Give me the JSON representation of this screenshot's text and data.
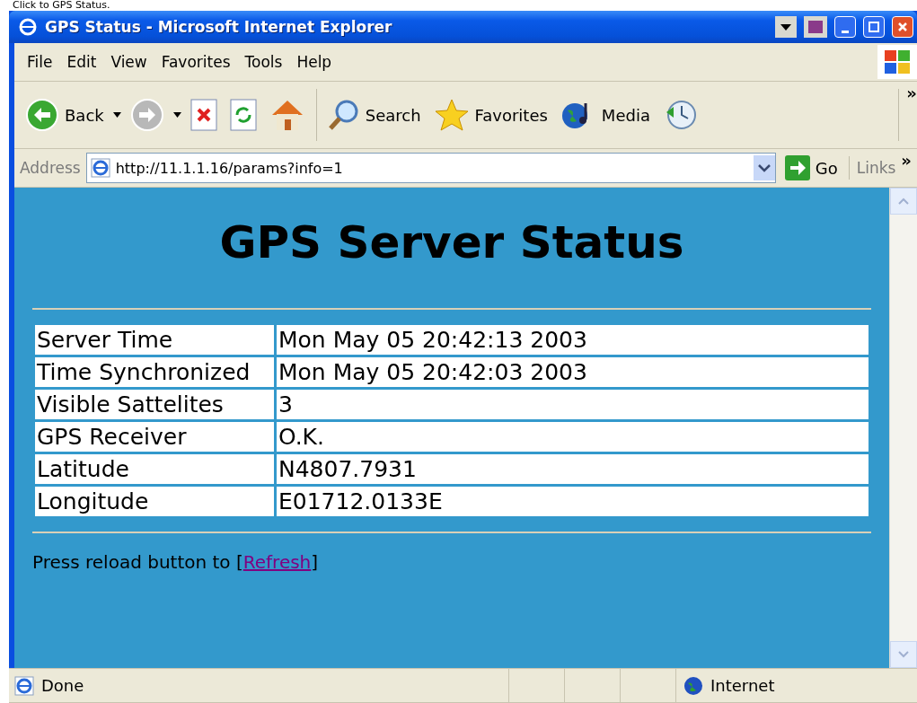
{
  "caption": "Click to GPS Status.",
  "window": {
    "title": "GPS Status - Microsoft Internet Explorer"
  },
  "menu": [
    "File",
    "Edit",
    "View",
    "Favorites",
    "Tools",
    "Help"
  ],
  "toolbar": [
    {
      "kind": "back",
      "label": "Back"
    },
    {
      "kind": "forward"
    },
    {
      "kind": "stop"
    },
    {
      "kind": "refresh"
    },
    {
      "kind": "home"
    },
    {
      "kind": "search",
      "label": "Search"
    },
    {
      "kind": "favorites",
      "label": "Favorites"
    },
    {
      "kind": "media",
      "label": "Media"
    },
    {
      "kind": "history"
    }
  ],
  "toolbar_overflow": "»",
  "address": {
    "label": "Address",
    "value": "http://11.1.1.16/params?info=1",
    "go": "Go",
    "links": "Links",
    "overflow": "»"
  },
  "page": {
    "heading": "GPS Server Status",
    "rows": [
      {
        "label": "Server Time",
        "value": "Mon May 05 20:42:13 2003"
      },
      {
        "label": "Time Synchronized",
        "value": "Mon May 05 20:42:03 2003"
      },
      {
        "label": "Visible Sattelites",
        "value": "3"
      },
      {
        "label": "GPS Receiver",
        "value": "O.K."
      },
      {
        "label": "Latitude",
        "value": "N4807.7931"
      },
      {
        "label": "Longitude",
        "value": "E01712.0133E"
      }
    ],
    "footer": {
      "before": "Press reload button to [",
      "link": "Refresh",
      "after": "]"
    }
  },
  "status_bar": {
    "text": "Done",
    "zone": "Internet"
  }
}
